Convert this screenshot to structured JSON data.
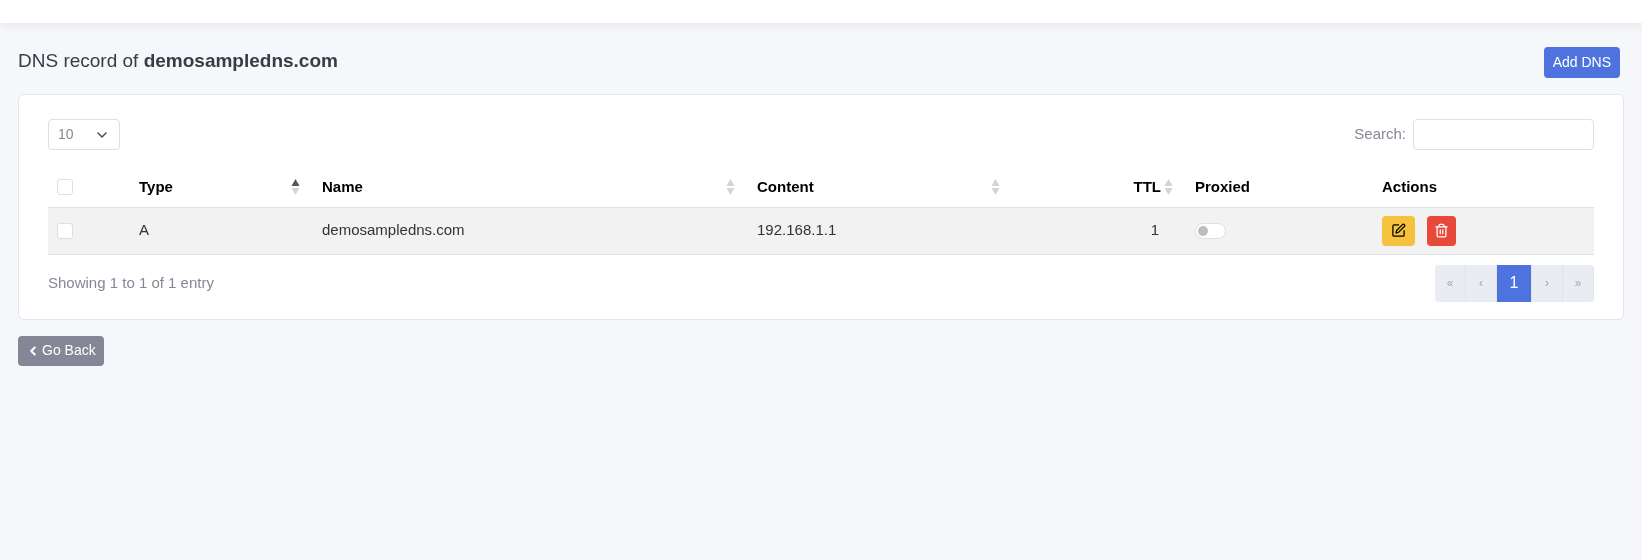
{
  "title": "DNS record of **demosampledns.com**",
  "add_button": "Add DNS",
  "page_length": "10",
  "search": {
    "label": "Search:"
  },
  "table": {
    "select_all": {
      "checked": false
    },
    "columns": [
      {
        "label": "Type",
        "sortable": true,
        "sorted": true,
        "numeric": false
      },
      {
        "label": "Name",
        "sortable": true,
        "sorted": false,
        "numeric": false
      },
      {
        "label": "Content",
        "sortable": true,
        "sorted": false,
        "numeric": false
      },
      {
        "label": "TTL",
        "sortable": true,
        "sorted": false,
        "numeric": true
      },
      {
        "label": "Proxied",
        "sortable": false,
        "numeric": false
      },
      {
        "label": "Actions",
        "sortable": false,
        "numeric": false
      }
    ],
    "rows": [
      {
        "checked": false,
        "type": "A",
        "name": "demosampledns.com",
        "content": "192.168.1.1",
        "ttl": "1",
        "proxied": false
      }
    ]
  },
  "info": "Showing 1 to 1 of 1 entry",
  "pagination": [
    {
      "label": "«",
      "selected": false
    },
    {
      "label": "‹",
      "selected": false
    },
    {
      "label": "1",
      "selected": true
    },
    {
      "label": "›",
      "selected": false
    },
    {
      "label": "»",
      "selected": false
    }
  ],
  "back_button": "Go Back"
}
